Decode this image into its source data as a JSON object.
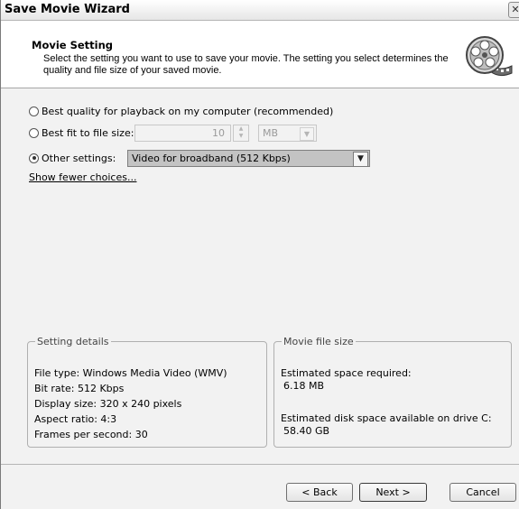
{
  "window": {
    "title": "Save Movie Wizard",
    "close_glyph": "✕"
  },
  "header": {
    "title": "Movie Setting",
    "description": "Select the setting you want to use to save your movie. The setting you select determines the quality and file size of your saved movie.",
    "icon": "film-reel-icon"
  },
  "options": {
    "best_quality": {
      "label": "Best quality for playback on my computer (recommended)",
      "selected": false
    },
    "best_fit": {
      "label": "Best fit to file size:",
      "selected": false,
      "size_value": "10",
      "unit": "MB"
    },
    "other": {
      "label": "Other settings:",
      "selected": true,
      "setting_value": "Video for broadband (512 Kbps)"
    }
  },
  "link": {
    "label": "Show fewer choices..."
  },
  "setting_details": {
    "title": "Setting details",
    "lines": [
      "File type: Windows Media Video (WMV)",
      "Bit rate: 512 Kbps",
      "Display size: 320 x 240 pixels",
      "Aspect ratio: 4:3",
      "Frames per second: 30"
    ]
  },
  "movie_file_size": {
    "title": "Movie file size",
    "required_label": "Estimated space required:",
    "required_value": "6.18 MB",
    "available_label": "Estimated disk space available on drive C:",
    "available_value": "58.40 GB"
  },
  "buttons": {
    "back": "< Back",
    "next": "Next >",
    "cancel": "Cancel"
  }
}
